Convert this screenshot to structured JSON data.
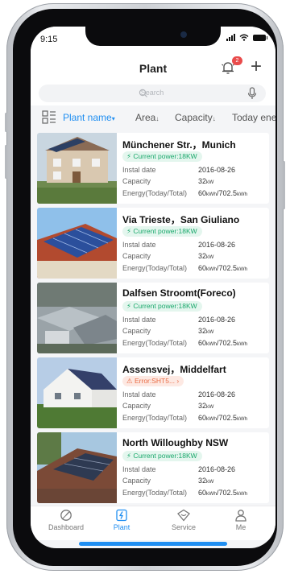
{
  "status": {
    "time": "9:15"
  },
  "header": {
    "title": "Plant",
    "notification_count": "2"
  },
  "search": {
    "placeholder": "Search"
  },
  "sort": {
    "items": [
      {
        "label": "Plant name",
        "arrow": "▾"
      },
      {
        "label": "Area",
        "arrow": "↓"
      },
      {
        "label": "Capacity",
        "arrow": "↓"
      },
      {
        "label": "Today ene",
        "arrow": ""
      }
    ]
  },
  "labels": {
    "install_date": "Instal date",
    "capacity": "Capacity",
    "energy": "Energy(Today/Total)"
  },
  "units": {
    "capacity": "kW",
    "energy": "kWh"
  },
  "plants": [
    {
      "name": "Münchener Str.，Munich",
      "status_type": "ok",
      "status": "Current power:18KW",
      "install_date": "2016-08-26",
      "capacity": "32",
      "energy_today": "60",
      "energy_total": "702.5"
    },
    {
      "name": "Via Trieste，San Giuliano",
      "status_type": "ok",
      "status": "Current power:18KW",
      "install_date": "2016-08-26",
      "capacity": "32",
      "energy_today": "60",
      "energy_total": "702.5"
    },
    {
      "name": "Dalfsen Stroomt(Foreco)",
      "status_type": "ok",
      "status": "Current power:18KW",
      "install_date": "2016-08-26",
      "capacity": "32",
      "energy_today": "60",
      "energy_total": "702.5"
    },
    {
      "name": "Assensvej，Middelfart",
      "status_type": "error",
      "status": "Error:SHT5...",
      "install_date": "2016-08-26",
      "capacity": "32",
      "energy_today": "60",
      "energy_total": "702.5"
    },
    {
      "name": "North Willoughby NSW",
      "status_type": "ok",
      "status": "Current power:18KW",
      "install_date": "2016-08-26",
      "capacity": "32",
      "energy_today": "60",
      "energy_total": "702.5"
    }
  ],
  "tabs": [
    {
      "label": "Dashboard",
      "icon": "dashboard-icon"
    },
    {
      "label": "Plant",
      "icon": "plant-icon",
      "active": true
    },
    {
      "label": "Service",
      "icon": "service-icon"
    },
    {
      "label": "Me",
      "icon": "me-icon"
    }
  ],
  "colors": {
    "accent": "#1f8ef1",
    "ok": "#19a86b",
    "error": "#ea6d46",
    "badge": "#e94b4b"
  }
}
